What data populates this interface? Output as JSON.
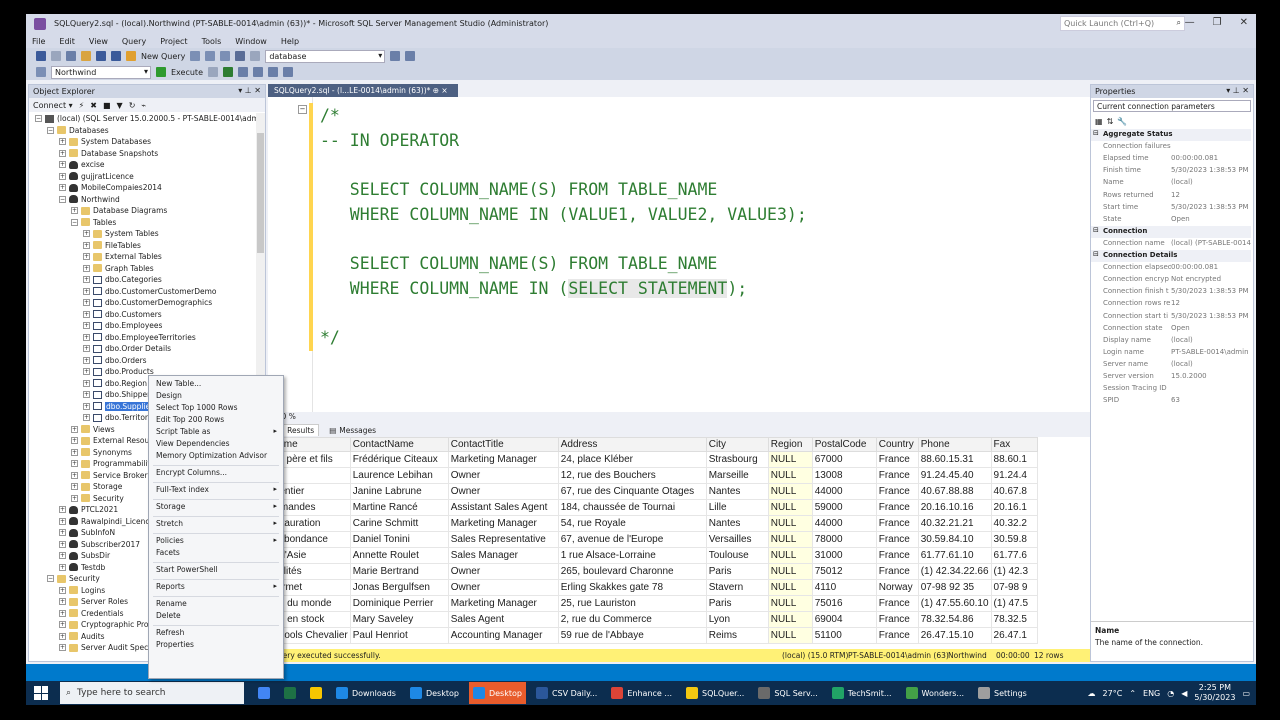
{
  "window": {
    "title": "SQLQuery2.sql - (local).Northwind (PT-SABLE-0014\\admin (63))* - Microsoft SQL Server Management Studio (Administrator)",
    "quick_launch_placeholder": "Quick Launch (Ctrl+Q)"
  },
  "menu": [
    "File",
    "Edit",
    "View",
    "Query",
    "Project",
    "Tools",
    "Window",
    "Help"
  ],
  "toolbar": {
    "new_query": "New Query",
    "database_combo": "database",
    "db_selector": "Northwind",
    "execute": "Execute"
  },
  "object_explorer": {
    "title": "Object Explorer",
    "connect": "Connect ▾",
    "nodes": [
      {
        "label": "(local) (SQL Server 15.0.2000.5 - PT-SABLE-0014\\admin)",
        "depth": 0,
        "icon": "server",
        "exp": "-"
      },
      {
        "label": "Databases",
        "depth": 1,
        "icon": "folder",
        "exp": "-"
      },
      {
        "label": "System Databases",
        "depth": 2,
        "icon": "folder",
        "exp": "+"
      },
      {
        "label": "Database Snapshots",
        "depth": 2,
        "icon": "folder",
        "exp": "+"
      },
      {
        "label": "excise",
        "depth": 2,
        "icon": "db",
        "exp": "+"
      },
      {
        "label": "gujjratLicence",
        "depth": 2,
        "icon": "db",
        "exp": "+"
      },
      {
        "label": "MobileCompaies2014",
        "depth": 2,
        "icon": "db",
        "exp": "+"
      },
      {
        "label": "Northwind",
        "depth": 2,
        "icon": "db",
        "exp": "-"
      },
      {
        "label": "Database Diagrams",
        "depth": 3,
        "icon": "folder",
        "exp": "+"
      },
      {
        "label": "Tables",
        "depth": 3,
        "icon": "folder",
        "exp": "-"
      },
      {
        "label": "System Tables",
        "depth": 4,
        "icon": "folder",
        "exp": "+"
      },
      {
        "label": "FileTables",
        "depth": 4,
        "icon": "folder",
        "exp": "+"
      },
      {
        "label": "External Tables",
        "depth": 4,
        "icon": "folder",
        "exp": "+"
      },
      {
        "label": "Graph Tables",
        "depth": 4,
        "icon": "folder",
        "exp": "+"
      },
      {
        "label": "dbo.Categories",
        "depth": 4,
        "icon": "table",
        "exp": "+"
      },
      {
        "label": "dbo.CustomerCustomerDemo",
        "depth": 4,
        "icon": "table",
        "exp": "+"
      },
      {
        "label": "dbo.CustomerDemographics",
        "depth": 4,
        "icon": "table",
        "exp": "+"
      },
      {
        "label": "dbo.Customers",
        "depth": 4,
        "icon": "table",
        "exp": "+"
      },
      {
        "label": "dbo.Employees",
        "depth": 4,
        "icon": "table",
        "exp": "+"
      },
      {
        "label": "dbo.EmployeeTerritories",
        "depth": 4,
        "icon": "table",
        "exp": "+"
      },
      {
        "label": "dbo.Order Details",
        "depth": 4,
        "icon": "table",
        "exp": "+"
      },
      {
        "label": "dbo.Orders",
        "depth": 4,
        "icon": "table",
        "exp": "+"
      },
      {
        "label": "dbo.Products",
        "depth": 4,
        "icon": "table",
        "exp": "+"
      },
      {
        "label": "dbo.Region",
        "depth": 4,
        "icon": "table",
        "exp": "+"
      },
      {
        "label": "dbo.Shippers",
        "depth": 4,
        "icon": "table",
        "exp": "+"
      },
      {
        "label": "dbo.Suppliers",
        "depth": 4,
        "icon": "table",
        "exp": "+",
        "selected": true
      },
      {
        "label": "dbo.Territories",
        "depth": 4,
        "icon": "table",
        "exp": "+"
      },
      {
        "label": "Views",
        "depth": 3,
        "icon": "folder",
        "exp": "+"
      },
      {
        "label": "External Resources",
        "depth": 3,
        "icon": "folder",
        "exp": "+"
      },
      {
        "label": "Synonyms",
        "depth": 3,
        "icon": "folder",
        "exp": "+"
      },
      {
        "label": "Programmability",
        "depth": 3,
        "icon": "folder",
        "exp": "+"
      },
      {
        "label": "Service Broker",
        "depth": 3,
        "icon": "folder",
        "exp": "+"
      },
      {
        "label": "Storage",
        "depth": 3,
        "icon": "folder",
        "exp": "+"
      },
      {
        "label": "Security",
        "depth": 3,
        "icon": "folder",
        "exp": "+"
      },
      {
        "label": "PTCL2021",
        "depth": 2,
        "icon": "db",
        "exp": "+"
      },
      {
        "label": "Rawalpindi_Licence",
        "depth": 2,
        "icon": "db",
        "exp": "+"
      },
      {
        "label": "SubInfoN",
        "depth": 2,
        "icon": "db",
        "exp": "+"
      },
      {
        "label": "Subscriber2017",
        "depth": 2,
        "icon": "db",
        "exp": "+"
      },
      {
        "label": "SubsDir",
        "depth": 2,
        "icon": "db",
        "exp": "+"
      },
      {
        "label": "Testdb",
        "depth": 2,
        "icon": "db",
        "exp": "+"
      },
      {
        "label": "Security",
        "depth": 1,
        "icon": "folder",
        "exp": "-"
      },
      {
        "label": "Logins",
        "depth": 2,
        "icon": "folder",
        "exp": "+"
      },
      {
        "label": "Server Roles",
        "depth": 2,
        "icon": "folder",
        "exp": "+"
      },
      {
        "label": "Credentials",
        "depth": 2,
        "icon": "folder",
        "exp": "+"
      },
      {
        "label": "Cryptographic Providers",
        "depth": 2,
        "icon": "folder",
        "exp": "+"
      },
      {
        "label": "Audits",
        "depth": 2,
        "icon": "folder",
        "exp": "+"
      },
      {
        "label": "Server Audit Specifications",
        "depth": 2,
        "icon": "folder",
        "exp": "+"
      }
    ]
  },
  "context_menu": [
    {
      "label": "New Table...",
      "sub": false
    },
    {
      "label": "Design",
      "sub": false
    },
    {
      "label": "Select Top 1000 Rows",
      "sub": false
    },
    {
      "label": "Edit Top 200 Rows",
      "sub": false
    },
    {
      "label": "Script Table as",
      "sub": true
    },
    {
      "label": "View Dependencies",
      "sub": false
    },
    {
      "label": "Memory Optimization Advisor",
      "sub": false
    },
    {
      "sep": true
    },
    {
      "label": "Encrypt Columns...",
      "sub": false
    },
    {
      "sep": true
    },
    {
      "label": "Full-Text index",
      "sub": true
    },
    {
      "sep": true
    },
    {
      "label": "Storage",
      "sub": true
    },
    {
      "sep": true
    },
    {
      "label": "Stretch",
      "sub": true
    },
    {
      "sep": true
    },
    {
      "label": "Policies",
      "sub": true
    },
    {
      "label": "Facets",
      "sub": false
    },
    {
      "sep": true
    },
    {
      "label": "Start PowerShell",
      "sub": false
    },
    {
      "sep": true
    },
    {
      "label": "Reports",
      "sub": true
    },
    {
      "sep": true
    },
    {
      "label": "Rename",
      "sub": false
    },
    {
      "label": "Delete",
      "sub": false
    },
    {
      "sep": true
    },
    {
      "label": "Refresh",
      "sub": false
    },
    {
      "label": "Properties",
      "sub": false
    }
  ],
  "editor": {
    "tab_label": "SQLQuery2.sql - (l...LE-0014\\admin (63))*  ⊕ ×",
    "lines": [
      {
        "text": "/*"
      },
      {
        "text": "-- IN OPERATOR"
      },
      {
        "text": ""
      },
      {
        "text": "   SELECT COLUMN_NAME(S) FROM TABLE_NAME"
      },
      {
        "text": "   WHERE COLUMN_NAME IN (VALUE1, VALUE2, VALUE3);"
      },
      {
        "text": ""
      },
      {
        "text": "   SELECT COLUMN_NAME(S) FROM TABLE_NAME"
      },
      {
        "text": "   WHERE COLUMN_NAME IN (SELECT STATEMENT);"
      },
      {
        "text": ""
      },
      {
        "text": "*/"
      }
    ],
    "zoom": "100 %"
  },
  "results": {
    "tab_results": "Results",
    "tab_messages": "Messages",
    "columns": [
      "Name",
      "ContactName",
      "ContactTitle",
      "Address",
      "City",
      "Region",
      "PostalCode",
      "Country",
      "Phone",
      "Fax"
    ],
    "rows": [
      [
        "dsl père et fils",
        "Frédérique Citeaux",
        "Marketing Manager",
        "24, place Kléber",
        "Strasbourg",
        "NULL",
        "67000",
        "France",
        "88.60.15.31",
        "88.60.1"
      ],
      [
        "",
        "Laurence Lebihan",
        "Owner",
        "12, rue des Bouchers",
        "Marseille",
        "NULL",
        "13008",
        "France",
        "91.24.45.40",
        "91.24.4"
      ],
      [
        "e entier",
        "Janine Labrune",
        "Owner",
        "67, rue des Cinquante Otages",
        "Nantes",
        "NULL",
        "44000",
        "France",
        "40.67.88.88",
        "40.67.8"
      ],
      [
        "urmandes",
        "Martine Rancé",
        "Assistant Sales Agent",
        "184, chaussée de Tournai",
        "Lille",
        "NULL",
        "59000",
        "France",
        "20.16.10.16",
        "20.16.1"
      ],
      [
        "estauration",
        "Carine Schmitt",
        "Marketing Manager",
        "54, rue Royale",
        "Nantes",
        "NULL",
        "44000",
        "France",
        "40.32.21.21",
        "40.32.2"
      ],
      [
        "d'abondance",
        "Daniel Tonini",
        "Sales Representative",
        "67, avenue de l'Europe",
        "Versailles",
        "NULL",
        "78000",
        "France",
        "30.59.84.10",
        "30.59.8"
      ],
      [
        "n d'Asie",
        "Annette Roulet",
        "Sales Manager",
        "1 rue Alsace-Lorraine",
        "Toulouse",
        "NULL",
        "31000",
        "France",
        "61.77.61.10",
        "61.77.6"
      ],
      [
        "cialités",
        "Marie Bertrand",
        "Owner",
        "265, boulevard Charonne",
        "Paris",
        "NULL",
        "75012",
        "France",
        "(1) 42.34.22.66",
        "(1) 42.3"
      ],
      [
        "ourmet",
        "Jonas Bergulfsen",
        "Owner",
        "Erling Skakkes gate 78",
        "Stavern",
        "NULL",
        "4110",
        "Norway",
        "07-98 92 35",
        "07-98 9"
      ],
      [
        "0 s du monde",
        "Dominique Perrier",
        "Marketing Manager",
        "25, rue Lauriston",
        "Paris",
        "NULL",
        "75016",
        "France",
        "(1) 47.55.60.10",
        "(1) 47.5"
      ],
      [
        "1 s en stock",
        "Mary Saveley",
        "Sales Agent",
        "2, rue du Commerce",
        "Lyon",
        "NULL",
        "69004",
        "France",
        "78.32.54.86",
        "78.32.5"
      ],
      [
        "2 cools Chevalier",
        "Paul Henriot",
        "Accounting Manager",
        "59 rue de l'Abbaye",
        "Reims",
        "NULL",
        "51100",
        "France",
        "26.47.15.10",
        "26.47.1"
      ]
    ],
    "status": "Query executed successfully.",
    "status_right": [
      "(local) (15.0 RTM)",
      "PT-SABLE-0014\\admin (63)",
      "Northwind",
      "00:00:00",
      "12 rows"
    ]
  },
  "properties": {
    "title": "Properties",
    "combo": "Current connection parameters",
    "rows": [
      {
        "cat": true,
        "k": "Aggregate Status"
      },
      {
        "k": "Connection failures",
        "v": ""
      },
      {
        "k": "Elapsed time",
        "v": "00:00:00.081"
      },
      {
        "k": "Finish time",
        "v": "5/30/2023 1:38:53 PM"
      },
      {
        "k": "Name",
        "v": "(local)"
      },
      {
        "k": "Rows returned",
        "v": "12"
      },
      {
        "k": "Start time",
        "v": "5/30/2023 1:38:53 PM"
      },
      {
        "k": "State",
        "v": "Open"
      },
      {
        "cat": true,
        "k": "Connection"
      },
      {
        "k": "Connection name",
        "v": "(local) (PT-SABLE-0014\\"
      },
      {
        "cat": true,
        "k": "Connection Details"
      },
      {
        "k": "Connection elapsed",
        "v": "00:00:00.081"
      },
      {
        "k": "Connection encryp",
        "v": "Not encrypted"
      },
      {
        "k": "Connection finish t",
        "v": "5/30/2023 1:38:53 PM"
      },
      {
        "k": "Connection rows re",
        "v": "12"
      },
      {
        "k": "Connection start ti",
        "v": "5/30/2023 1:38:53 PM"
      },
      {
        "k": "Connection state",
        "v": "Open"
      },
      {
        "k": "Display name",
        "v": "(local)"
      },
      {
        "k": "Login name",
        "v": "PT-SABLE-0014\\admin"
      },
      {
        "k": "Server name",
        "v": "(local)"
      },
      {
        "k": "Server version",
        "v": "15.0.2000"
      },
      {
        "k": "Session Tracing ID",
        "v": ""
      },
      {
        "k": "SPID",
        "v": "63"
      }
    ],
    "desc_name": "Name",
    "desc_text": "The name of the connection."
  },
  "taskbar": {
    "search_placeholder": "Type here to search",
    "apps": [
      {
        "label": "",
        "color": "#4285f4"
      },
      {
        "label": "",
        "color": "#1e7145"
      },
      {
        "label": "",
        "color": "#f7c600"
      },
      {
        "label": "Downloads",
        "color": "#1e88e5"
      },
      {
        "label": "Desktop",
        "color": "#1e88e5"
      },
      {
        "label": "Desktop",
        "color": "#1e88e5",
        "active": true
      },
      {
        "label": "CSV Daily...",
        "color": "#2b579a"
      },
      {
        "label": "Enhance ...",
        "color": "#db4437"
      },
      {
        "label": "SQLQuer...",
        "color": "#f2c811"
      },
      {
        "label": "SQL Serv...",
        "color": "#6a6a6a"
      },
      {
        "label": "TechSmit...",
        "color": "#21a366"
      },
      {
        "label": "Wonders...",
        "color": "#43a047"
      },
      {
        "label": "Settings",
        "color": "#9e9e9e"
      }
    ],
    "weather": "27°C",
    "lang": "ENG",
    "time": "2:25 PM",
    "date": "5/30/2023"
  }
}
